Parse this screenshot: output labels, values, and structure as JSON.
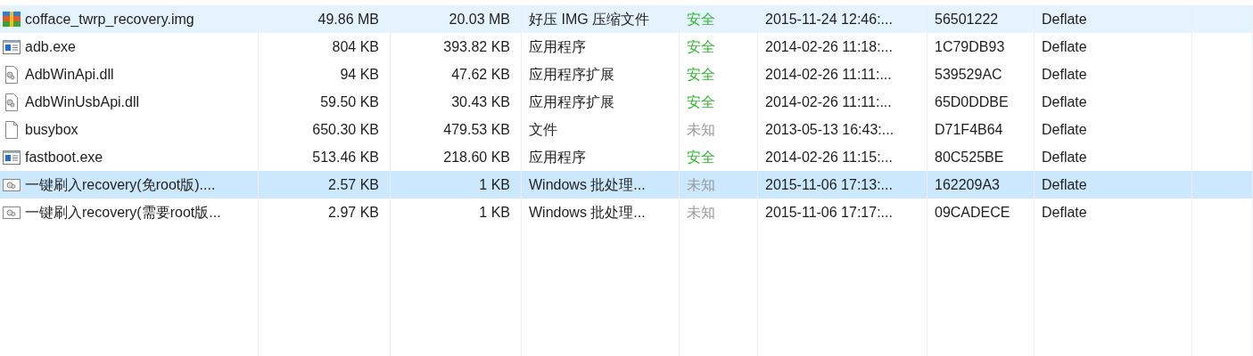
{
  "files": [
    {
      "kind": "archive",
      "name": "cofface_twrp_recovery.img",
      "size": "49.86 MB",
      "packed": "20.03 MB",
      "type": "好压 IMG 压缩文件",
      "safety": "安全",
      "verified": true,
      "modified": "2015-11-24 12:46:...",
      "crc": "56501222",
      "method": "Deflate",
      "selected": false,
      "hovered": true
    },
    {
      "kind": "exe",
      "name": "adb.exe",
      "size": "804 KB",
      "packed": "393.82 KB",
      "type": "应用程序",
      "safety": "安全",
      "verified": true,
      "modified": "2014-02-26 11:18:...",
      "crc": "1C79DB93",
      "method": "Deflate",
      "selected": false,
      "hovered": false
    },
    {
      "kind": "dll",
      "name": "AdbWinApi.dll",
      "size": "94 KB",
      "packed": "47.62 KB",
      "type": "应用程序扩展",
      "safety": "安全",
      "verified": true,
      "modified": "2014-02-26 11:11:...",
      "crc": "539529AC",
      "method": "Deflate",
      "selected": false,
      "hovered": false
    },
    {
      "kind": "dll",
      "name": "AdbWinUsbApi.dll",
      "size": "59.50 KB",
      "packed": "30.43 KB",
      "type": "应用程序扩展",
      "safety": "安全",
      "verified": true,
      "modified": "2014-02-26 11:11:...",
      "crc": "65D0DDBE",
      "method": "Deflate",
      "selected": false,
      "hovered": false
    },
    {
      "kind": "file",
      "name": "busybox",
      "size": "650.30 KB",
      "packed": "479.53 KB",
      "type": "文件",
      "safety": "未知",
      "verified": false,
      "modified": "2013-05-13 16:43:...",
      "crc": "D71F4B64",
      "method": "Deflate",
      "selected": false,
      "hovered": false
    },
    {
      "kind": "exe",
      "name": "fastboot.exe",
      "size": "513.46 KB",
      "packed": "218.60 KB",
      "type": "应用程序",
      "safety": "安全",
      "verified": true,
      "modified": "2014-02-26 11:15:...",
      "crc": "80C525BE",
      "method": "Deflate",
      "selected": false,
      "hovered": false
    },
    {
      "kind": "bat",
      "name": "一键刷入recovery(免root版)....",
      "size": "2.57 KB",
      "packed": "1 KB",
      "type": "Windows 批处理...",
      "safety": "未知",
      "verified": false,
      "modified": "2015-11-06 17:13:...",
      "crc": "162209A3",
      "method": "Deflate",
      "selected": true,
      "hovered": false
    },
    {
      "kind": "bat",
      "name": "一键刷入recovery(需要root版...",
      "size": "2.97 KB",
      "packed": "1 KB",
      "type": "Windows 批处理...",
      "safety": "未知",
      "verified": false,
      "modified": "2015-11-06 17:17:...",
      "crc": "09CADECE",
      "method": "Deflate",
      "selected": false,
      "hovered": false
    }
  ]
}
